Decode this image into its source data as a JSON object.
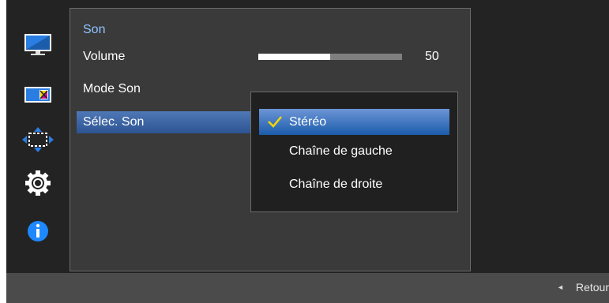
{
  "panel": {
    "title": "Son",
    "items": [
      {
        "label": "Volume"
      },
      {
        "label": "Mode Son"
      },
      {
        "label": "Sélec. Son",
        "selected": true
      }
    ],
    "volume": {
      "value": "50",
      "fraction": 0.5
    }
  },
  "dropdown": {
    "options": [
      {
        "label": "Stéréo",
        "selected": true
      },
      {
        "label": "Chaîne de gauche"
      },
      {
        "label": "Chaîne de droite"
      }
    ]
  },
  "sidebar": {
    "icons": [
      "picture-icon",
      "color-icon",
      "screen-size-icon",
      "settings-gear-icon",
      "info-icon"
    ],
    "info_color": "#1e88ff"
  },
  "footer": {
    "back_label": "Retour"
  },
  "colors": {
    "accent_title": "#8fc4ff",
    "selection": "#2d5492",
    "check": "#f5d800"
  }
}
